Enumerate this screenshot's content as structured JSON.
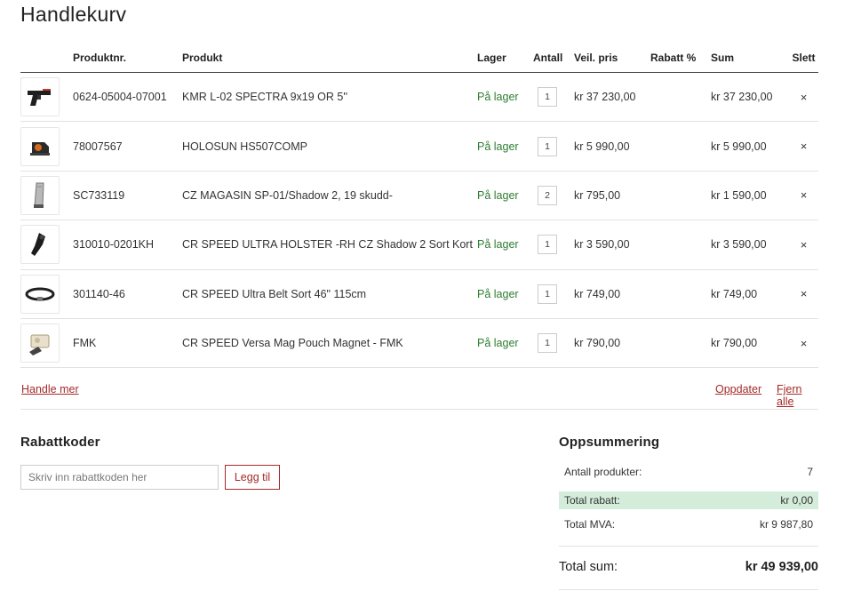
{
  "title": "Handlekurv",
  "columns": {
    "nr": "Produktnr.",
    "product": "Produkt",
    "stock": "Lager",
    "qty": "Antall",
    "price": "Veil. pris",
    "discount": "Rabatt %",
    "sum": "Sum",
    "delete": "Slett"
  },
  "items": [
    {
      "nr": "0624-05004-07001",
      "name": "KMR L-02 SPECTRA 9x19 OR 5''",
      "stock": "På lager",
      "qty": "1",
      "price": "kr 37 230,00",
      "discount": "",
      "sum": "kr 37 230,00",
      "icon": "pistol-icon"
    },
    {
      "nr": "78007567",
      "name": "HOLOSUN HS507COMP",
      "stock": "På lager",
      "qty": "1",
      "price": "kr 5 990,00",
      "discount": "",
      "sum": "kr 5 990,00",
      "icon": "red-dot-sight-icon"
    },
    {
      "nr": "SC733119",
      "name": "CZ MAGASIN SP-01/Shadow 2, 19 skudd-",
      "stock": "På lager",
      "qty": "2",
      "price": "kr 795,00",
      "discount": "",
      "sum": "kr 1 590,00",
      "icon": "magazine-icon"
    },
    {
      "nr": "310010-0201KH",
      "name": "CR SPEED ULTRA HOLSTER -RH CZ Shadow 2 Sort Kort",
      "stock": "På lager",
      "qty": "1",
      "price": "kr 3 590,00",
      "discount": "",
      "sum": "kr 3 590,00",
      "icon": "holster-icon"
    },
    {
      "nr": "301140-46",
      "name": "CR SPEED Ultra Belt Sort 46\" 115cm",
      "stock": "På lager",
      "qty": "1",
      "price": "kr 749,00",
      "discount": "",
      "sum": "kr 749,00",
      "icon": "belt-icon"
    },
    {
      "nr": "FMK",
      "name": "CR SPEED Versa Mag Pouch Magnet - FMK",
      "stock": "På lager",
      "qty": "1",
      "price": "kr 790,00",
      "discount": "",
      "sum": "kr 790,00",
      "icon": "mag-pouch-icon"
    }
  ],
  "delete_symbol": "×",
  "actions": {
    "continue_shopping": "Handle mer",
    "update": "Oppdater",
    "remove_all": "Fjern alle"
  },
  "discount": {
    "title": "Rabattkoder",
    "placeholder": "Skriv inn rabattkoden her",
    "button": "Legg til"
  },
  "summary": {
    "title": "Oppsummering",
    "count_label": "Antall produkter:",
    "count_value": "7",
    "discount_label": "Total rabatt:",
    "discount_value": "kr 0,00",
    "vat_label": "Total MVA:",
    "vat_value": "kr 9 987,80",
    "total_label": "Total sum:",
    "total_value": "kr 49 939,00"
  },
  "colors": {
    "accent": "#a52a2a",
    "stock": "#2e7d32",
    "discount_highlight": "#d4eddb"
  }
}
